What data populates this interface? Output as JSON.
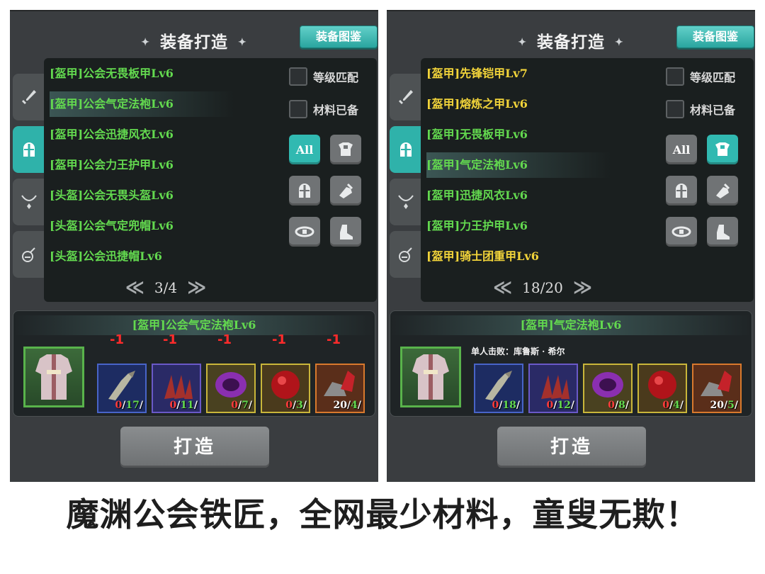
{
  "caption": "魔渊公会铁匠，全网最少材料，童叟无欺！",
  "left": {
    "title": "装备打造",
    "guide_label": "装备图鉴",
    "filters": {
      "level_match": "等级匹配",
      "materials_ready": "材料已备"
    },
    "category_all": "All",
    "items": [
      {
        "label": "[盔甲]公会无畏板甲Lv6",
        "color": "#63d94f"
      },
      {
        "label": "[盔甲]公会气定法袍Lv6",
        "color": "#63d94f"
      },
      {
        "label": "[盔甲]公会迅捷风衣Lv6",
        "color": "#63d94f"
      },
      {
        "label": "[盔甲]公会力王护甲Lv6",
        "color": "#63d94f"
      },
      {
        "label": "[头盔]公会无畏头盔Lv6",
        "color": "#63d94f"
      },
      {
        "label": "[头盔]公会气定兜帽Lv6",
        "color": "#63d94f"
      },
      {
        "label": "[头盔]公会迅捷帽Lv6",
        "color": "#63d94f"
      }
    ],
    "pager": {
      "prev": "≪",
      "page": "3/4",
      "next": "≫"
    },
    "craft": {
      "title": "[盔甲]公会气定法袍Lv6",
      "note": "",
      "reductions": [
        "-1",
        "-1",
        "-1",
        "-1",
        "-1"
      ],
      "materials": [
        {
          "own": "0",
          "need": "17",
          "icon": "bone-claw-icon"
        },
        {
          "own": "0",
          "need": "11",
          "icon": "red-claws-icon"
        },
        {
          "own": "0",
          "need": "7",
          "icon": "purple-orb-icon"
        },
        {
          "own": "0",
          "need": "3",
          "icon": "red-gem-icon"
        },
        {
          "own": "20",
          "need": "4",
          "icon": "ore-crystal-icon"
        }
      ]
    },
    "make_label": "打造"
  },
  "right": {
    "title": "装备打造",
    "guide_label": "装备图鉴",
    "filters": {
      "level_match": "等级匹配",
      "materials_ready": "材料已备"
    },
    "category_all": "All",
    "items": [
      {
        "label": "[盔甲]先锋铠甲Lv7",
        "color": "#f2d43a"
      },
      {
        "label": "[盔甲]熔炼之甲Lv6",
        "color": "#f2d43a"
      },
      {
        "label": "[盔甲]无畏板甲Lv6",
        "color": "#63d94f"
      },
      {
        "label": "[盔甲]气定法袍Lv6",
        "color": "#63d94f"
      },
      {
        "label": "[盔甲]迅捷风衣Lv6",
        "color": "#63d94f"
      },
      {
        "label": "[盔甲]力王护甲Lv6",
        "color": "#63d94f"
      },
      {
        "label": "[盔甲]骑士团重甲Lv6",
        "color": "#f2d43a"
      }
    ],
    "pager": {
      "prev": "≪",
      "page": "18/20",
      "next": "≫"
    },
    "craft": {
      "title": "[盔甲]气定法袍Lv6",
      "note": "单人击败：库鲁斯 · 希尔",
      "materials": [
        {
          "own": "0",
          "need": "18",
          "icon": "bone-claw-icon"
        },
        {
          "own": "0",
          "need": "12",
          "icon": "red-claws-icon"
        },
        {
          "own": "0",
          "need": "8",
          "icon": "purple-orb-icon"
        },
        {
          "own": "0",
          "need": "4",
          "icon": "red-gem-icon"
        },
        {
          "own": "20",
          "need": "5",
          "icon": "ore-crystal-icon"
        }
      ]
    },
    "make_label": "打造"
  }
}
